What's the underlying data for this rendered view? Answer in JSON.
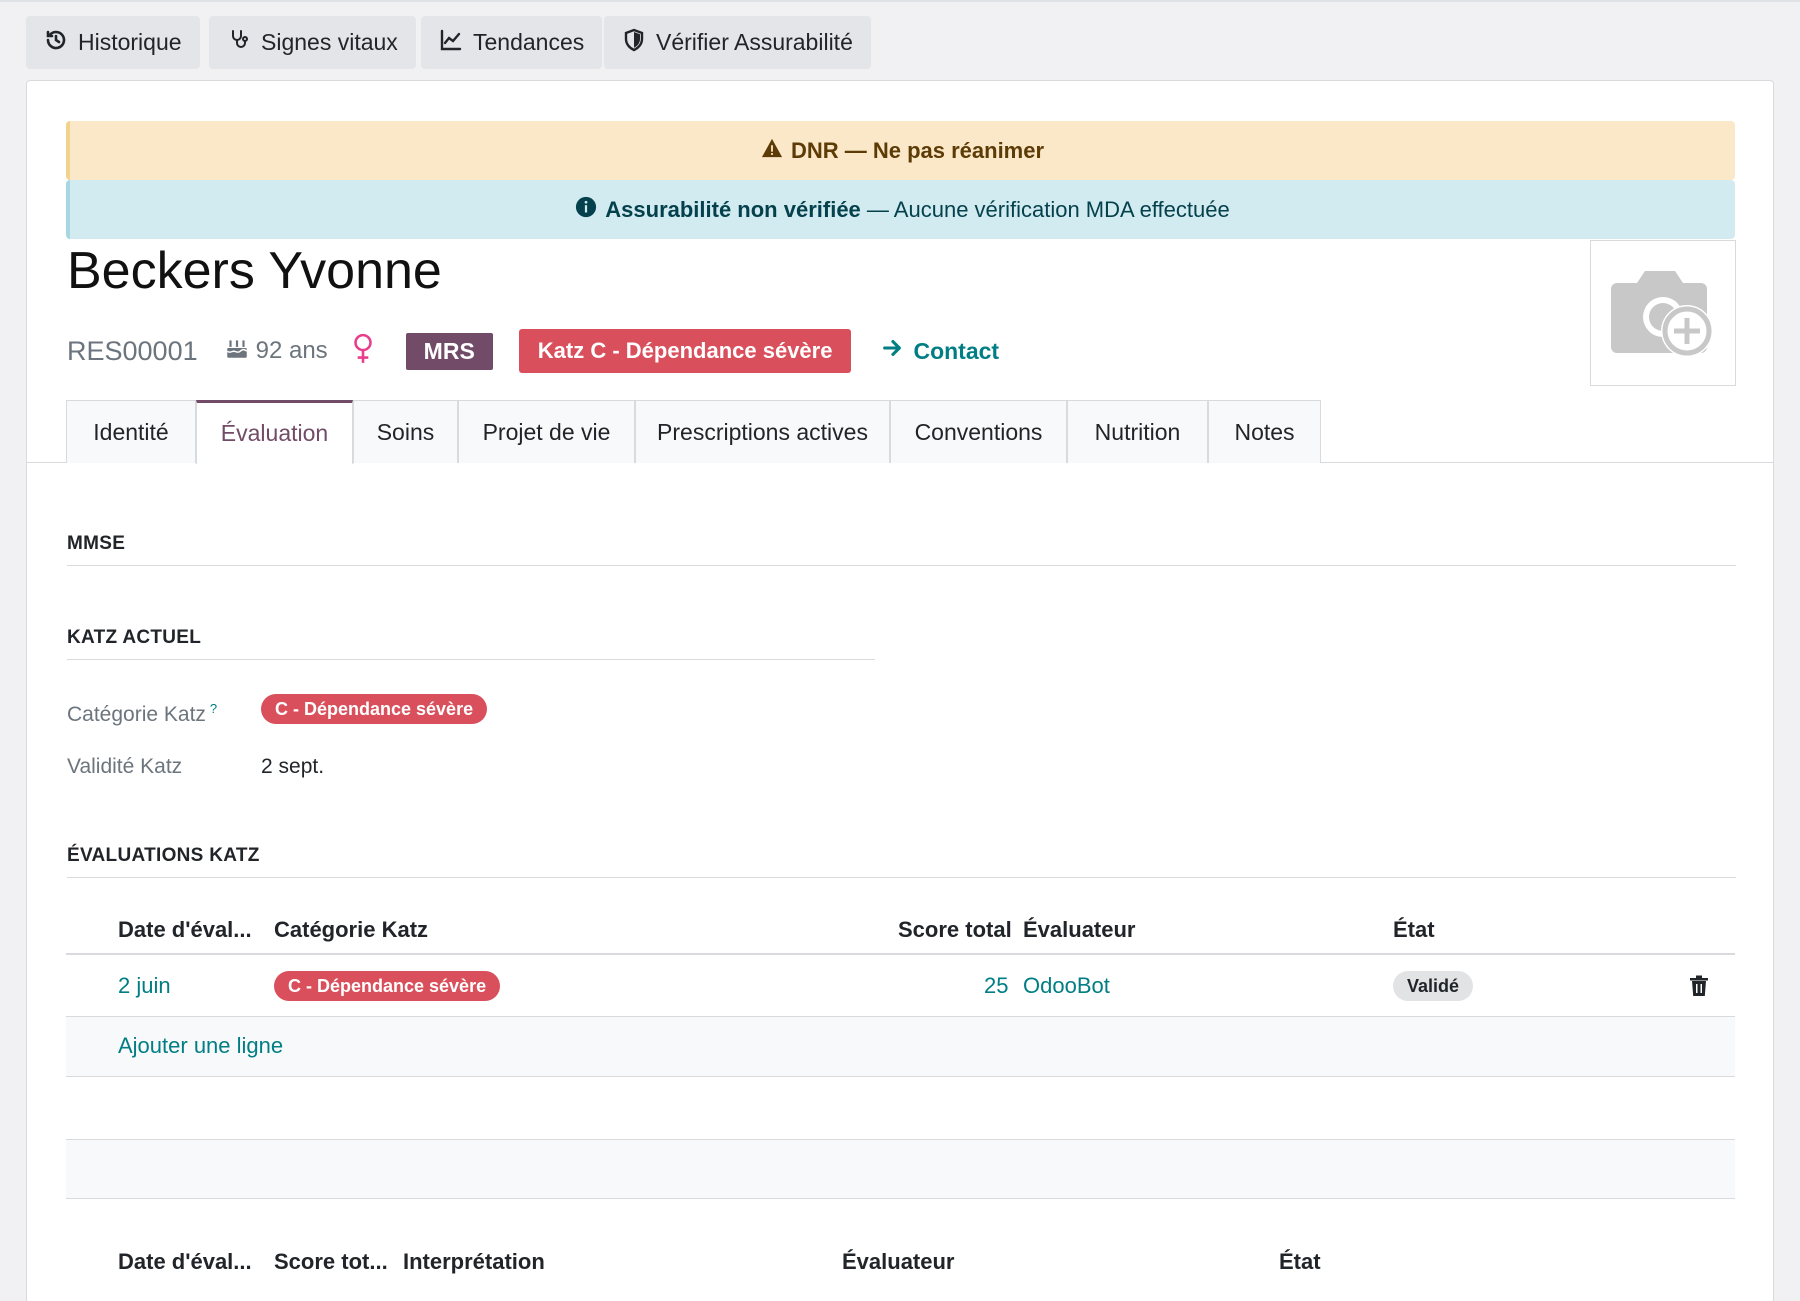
{
  "toolbar": {
    "history": "Historique",
    "vitals": "Signes vitaux",
    "trends": "Tendances",
    "verify": "Vérifier Assurabilité"
  },
  "alerts": {
    "dnr": "DNR — Ne pas réanimer",
    "insurability_bold": "Assurabilité non vérifiée",
    "insurability_rest": " — Aucune vérification MDA effectuée"
  },
  "resident": {
    "name": "Beckers Yvonne",
    "reference": "RES00001",
    "age": "92 ans",
    "type_badge": "MRS",
    "katz_badge": "Katz C - Dépendance sévère",
    "contact_label": "Contact"
  },
  "tabs": [
    {
      "label": "Identité"
    },
    {
      "label": "Évaluation"
    },
    {
      "label": "Soins"
    },
    {
      "label": "Projet de vie"
    },
    {
      "label": "Prescriptions actives"
    },
    {
      "label": "Conventions"
    },
    {
      "label": "Nutrition"
    },
    {
      "label": "Notes"
    }
  ],
  "active_tab": "Évaluation",
  "sections": {
    "mmse": "MMSE",
    "katz_current": "KATZ ACTUEL",
    "katz_evals": "ÉVALUATIONS KATZ"
  },
  "katz_current": {
    "category_label": "Catégorie Katz",
    "category_help": "?",
    "category_value": "C - Dépendance sévère",
    "validity_label": "Validité Katz",
    "validity_value": "2 sept."
  },
  "katz_table": {
    "headers": [
      "Date d'éval...",
      "Catégorie Katz",
      "Score total",
      "Évaluateur",
      "État"
    ],
    "rows": [
      {
        "date": "2 juin",
        "category": "C - Dépendance sévère",
        "score": "25",
        "evaluator": "OdooBot",
        "state": "Validé"
      }
    ],
    "add_line": "Ajouter une ligne"
  },
  "mmse_table": {
    "headers": [
      "Date d'éval...",
      "Score tot...",
      "Interprétation",
      "Évaluateur",
      "État"
    ]
  },
  "colors": {
    "primary": "#714b67",
    "link": "#017e84",
    "danger": "#d9505c",
    "warning_bg": "#fbe8c8",
    "info_bg": "#d2ebf1"
  }
}
